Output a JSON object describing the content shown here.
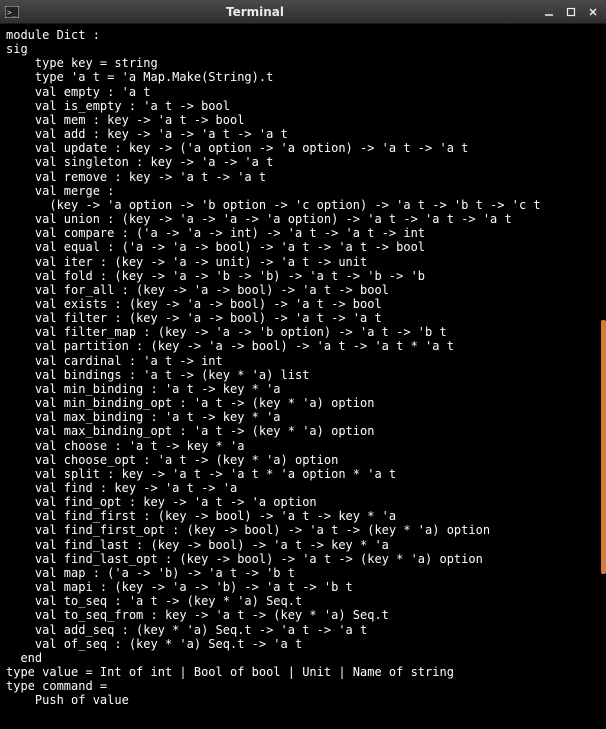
{
  "window": {
    "title": "Terminal",
    "minimize_tooltip": "Minimize",
    "maximize_tooltip": "Maximize",
    "close_tooltip": "Close"
  },
  "terminal": {
    "lines": [
      "module Dict :",
      "sig",
      "    type key = string",
      "    type 'a t = 'a Map.Make(String).t",
      "    val empty : 'a t",
      "    val is_empty : 'a t -> bool",
      "    val mem : key -> 'a t -> bool",
      "    val add : key -> 'a -> 'a t -> 'a t",
      "    val update : key -> ('a option -> 'a option) -> 'a t -> 'a t",
      "    val singleton : key -> 'a -> 'a t",
      "    val remove : key -> 'a t -> 'a t",
      "    val merge :",
      "      (key -> 'a option -> 'b option -> 'c option) -> 'a t -> 'b t -> 'c t",
      "    val union : (key -> 'a -> 'a -> 'a option) -> 'a t -> 'a t -> 'a t",
      "    val compare : ('a -> 'a -> int) -> 'a t -> 'a t -> int",
      "    val equal : ('a -> 'a -> bool) -> 'a t -> 'a t -> bool",
      "    val iter : (key -> 'a -> unit) -> 'a t -> unit",
      "    val fold : (key -> 'a -> 'b -> 'b) -> 'a t -> 'b -> 'b",
      "    val for_all : (key -> 'a -> bool) -> 'a t -> bool",
      "    val exists : (key -> 'a -> bool) -> 'a t -> bool",
      "    val filter : (key -> 'a -> bool) -> 'a t -> 'a t",
      "    val filter_map : (key -> 'a -> 'b option) -> 'a t -> 'b t",
      "    val partition : (key -> 'a -> bool) -> 'a t -> 'a t * 'a t",
      "    val cardinal : 'a t -> int",
      "    val bindings : 'a t -> (key * 'a) list",
      "    val min_binding : 'a t -> key * 'a",
      "    val min_binding_opt : 'a t -> (key * 'a) option",
      "    val max_binding : 'a t -> key * 'a",
      "    val max_binding_opt : 'a t -> (key * 'a) option",
      "    val choose : 'a t -> key * 'a",
      "    val choose_opt : 'a t -> (key * 'a) option",
      "    val split : key -> 'a t -> 'a t * 'a option * 'a t",
      "    val find : key -> 'a t -> 'a",
      "    val find_opt : key -> 'a t -> 'a option",
      "    val find_first : (key -> bool) -> 'a t -> key * 'a",
      "    val find_first_opt : (key -> bool) -> 'a t -> (key * 'a) option",
      "    val find_last : (key -> bool) -> 'a t -> key * 'a",
      "    val find_last_opt : (key -> bool) -> 'a t -> (key * 'a) option",
      "    val map : ('a -> 'b) -> 'a t -> 'b t",
      "    val mapi : (key -> 'a -> 'b) -> 'a t -> 'b t",
      "    val to_seq : 'a t -> (key * 'a) Seq.t",
      "    val to_seq_from : key -> 'a t -> (key * 'a) Seq.t",
      "    val add_seq : (key * 'a) Seq.t -> 'a t -> 'a t",
      "    val of_seq : (key * 'a) Seq.t -> 'a t",
      "  end",
      "type value = Int of int | Bool of bool | Unit | Name of string",
      "type command =",
      "    Push of value"
    ]
  }
}
